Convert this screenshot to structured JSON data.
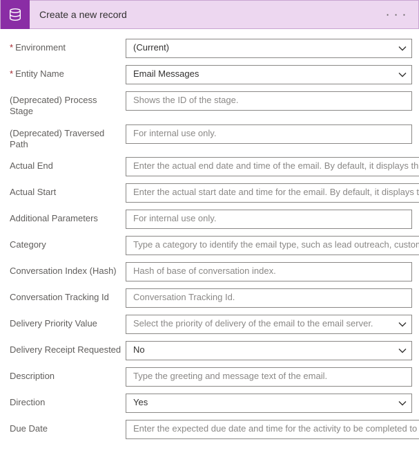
{
  "header": {
    "title": "Create a new record",
    "icon_name": "database-icon",
    "menu_label": "· · ·"
  },
  "fields": [
    {
      "label": "Environment",
      "required": true,
      "type": "select",
      "value": "(Current)",
      "placeholder": ""
    },
    {
      "label": "Entity Name",
      "required": true,
      "type": "select",
      "value": "Email Messages",
      "placeholder": ""
    },
    {
      "label": "(Deprecated) Process Stage",
      "required": false,
      "type": "text",
      "value": "",
      "placeholder": "Shows the ID of the stage."
    },
    {
      "label": "(Deprecated) Traversed Path",
      "required": false,
      "type": "text",
      "value": "",
      "placeholder": "For internal use only."
    },
    {
      "label": "Actual End",
      "required": false,
      "type": "text",
      "value": "",
      "placeholder": "Enter the actual end date and time of the email. By default, it displays the date"
    },
    {
      "label": "Actual Start",
      "required": false,
      "type": "text",
      "value": "",
      "placeholder": "Enter the actual start date and time for the email. By default, it displays the da"
    },
    {
      "label": "Additional Parameters",
      "required": false,
      "type": "text",
      "value": "",
      "placeholder": "For internal use only."
    },
    {
      "label": "Category",
      "required": false,
      "type": "text",
      "value": "",
      "placeholder": "Type a category to identify the email type, such as lead outreach, customer fol"
    },
    {
      "label": "Conversation Index (Hash)",
      "required": false,
      "type": "text",
      "value": "",
      "placeholder": "Hash of base of conversation index."
    },
    {
      "label": "Conversation Tracking Id",
      "required": false,
      "type": "text",
      "value": "",
      "placeholder": "Conversation Tracking Id."
    },
    {
      "label": "Delivery Priority Value",
      "required": false,
      "type": "select",
      "value": "",
      "placeholder": "Select the priority of delivery of the email to the email server."
    },
    {
      "label": "Delivery Receipt Requested",
      "required": false,
      "type": "select",
      "value": "No",
      "placeholder": ""
    },
    {
      "label": "Description",
      "required": false,
      "type": "text",
      "value": "",
      "placeholder": "Type the greeting and message text of the email."
    },
    {
      "label": "Direction",
      "required": false,
      "type": "select",
      "value": "Yes",
      "placeholder": ""
    },
    {
      "label": "Due Date",
      "required": false,
      "type": "text",
      "value": "",
      "placeholder": "Enter the expected due date and time for the activity to be completed to prov"
    }
  ]
}
